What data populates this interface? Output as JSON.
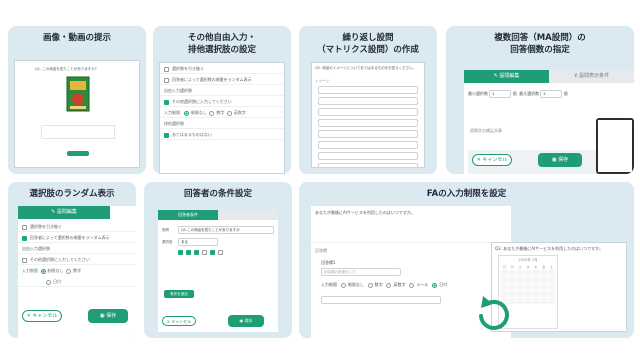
{
  "cards": {
    "c1": {
      "title": "画像・動画の提示"
    },
    "c2": {
      "title_line1": "その他自由入力・",
      "title_line2": "排他選択肢の設定"
    },
    "c3": {
      "title_line1": "繰り返し設問",
      "title_line2": "（マトリクス設問）の作成"
    },
    "c4": {
      "title_line1": "複数回答（MA設問）の",
      "title_line2": "回答個数の指定"
    },
    "c5": {
      "title": "選択肢のランダム表示"
    },
    "c6": {
      "title": "回答者の条件設定"
    },
    "c7": {
      "title": "FAの入力制限を設定"
    }
  },
  "ui": {
    "c1_question": "Q1. この商品を見たことがありますか？",
    "c2_rows": [
      "選択肢を引き継ぐ",
      "回答者によって選択肢の順番をランダム表示",
      "自由入力選択肢",
      "その他選択肢に入力してください",
      "入力制限",
      "排他選択肢",
      "あてはまるものはない"
    ],
    "c2_radios": [
      "制限なし",
      "数字",
      "英数字"
    ],
    "c3_question": "Q2. 商品のイメージについてあてはまるものをお答えください。",
    "c3_label": "イメージ",
    "c4_tab_edit": "設問編集",
    "c4_tab_logic": "設問表示条件",
    "c4_min_label": "最小選択数",
    "c4_max_label": "最大選択数",
    "c4_min_value": "1",
    "c4_max_value": "5",
    "c4_unit": "個",
    "c4_sub": "設問文の補足文章",
    "cancel": "キャンセル",
    "save": "保存",
    "c5_tab": "設問編集",
    "c5_rows": [
      "選択肢を引き継ぐ",
      "回答者によって選択肢の順番をランダム表示",
      "自由入力選択肢",
      "その他選択肢に入力してください"
    ],
    "c5_radio_label": "入力制限",
    "c5_radios": [
      "制限なし",
      "数字",
      "日付"
    ],
    "c6_tab": "回答者条件",
    "c6_field1": "設問",
    "c6_value1": "Q1.この商品を見たことがありますか",
    "c6_field2": "選択肢",
    "c6_value2": "ある",
    "c6_add": "条件を追加",
    "c7_question": "あなたが最後にAIサービスを利用したのはいつですか。",
    "c7_answer_label": "回答欄",
    "c7_format_label": "回答欄1",
    "c7_placeholder": "回答欄の数値を入力",
    "c7_limit_label": "入力制限",
    "c7_radios": [
      "制限なし",
      "数字",
      "英数字",
      "メール",
      "日付"
    ],
    "c7_zoom_question": "Q3. あなたが最後にAIサービスを利用したのはいつですか。",
    "c7_cal_header": "2023年 7月",
    "c7_weekdays": [
      "日",
      "月",
      "火",
      "水",
      "木",
      "金",
      "土"
    ]
  },
  "colors": {
    "card_bg": "#dbe9f1",
    "accent": "#1f9d77"
  }
}
